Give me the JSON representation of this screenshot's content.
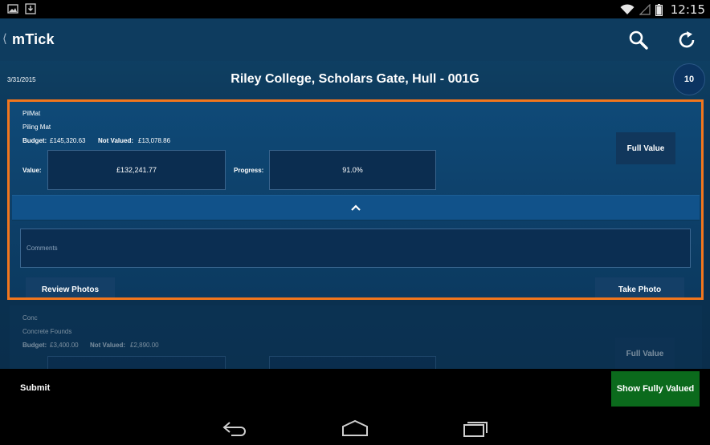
{
  "status_bar": {
    "time": "12:15"
  },
  "action_bar": {
    "title": "mTick",
    "icons": [
      "search-icon",
      "refresh-icon"
    ]
  },
  "header": {
    "date": "3/31/2015",
    "title": "Riley College, Scholars Gate, Hull - 001G",
    "badge": "10"
  },
  "items": [
    {
      "code": "PilMat",
      "name": "Piling Mat",
      "budget_label": "Budget:",
      "budget": "£145,320.63",
      "not_valued_label": "Not Valued:",
      "not_valued": "£13,078.86",
      "value_label": "Value:",
      "value": "£132,241.77",
      "progress_label": "Progress:",
      "progress": "91.0%",
      "full_value_label": "Full Value",
      "comments_placeholder": "Comments",
      "review_photos_label": "Review Photos",
      "take_photo_label": "Take Photo"
    },
    {
      "code": "Conc",
      "name": "Concrete Founds",
      "budget_label": "Budget:",
      "budget": "£3,400.00",
      "not_valued_label": "Not Valued:",
      "not_valued": "£2,890.00",
      "full_value_label": "Full Value"
    }
  ],
  "bottom_bar": {
    "submit_label": "Submit",
    "fully_valued_label": "Show Fully Valued"
  },
  "colors": {
    "highlight_border": "#f2761d",
    "accent_green": "#0b6a1c",
    "background_blue": "#0b3556"
  }
}
